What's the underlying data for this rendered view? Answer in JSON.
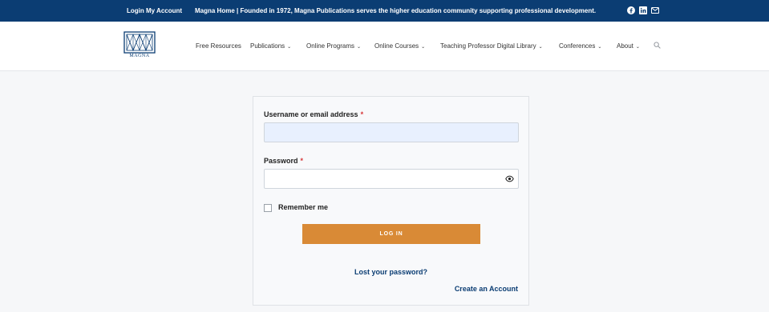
{
  "topbar": {
    "login": "Login",
    "my_account": "My Account",
    "tagline": "Magna Home | Founded in 1972, Magna Publications serves the higher education community supporting professional development.",
    "social_icons": [
      "facebook-icon",
      "linkedin-icon",
      "email-icon"
    ]
  },
  "header": {
    "logo_text": "MAGNA",
    "nav": [
      {
        "label": "Free Resources",
        "dropdown": false
      },
      {
        "label": "Publications",
        "dropdown": true
      },
      {
        "label": "Online Programs",
        "dropdown": true
      },
      {
        "label": "Online Courses",
        "dropdown": true
      },
      {
        "label": "Teaching Professor Digital Library",
        "dropdown": true
      },
      {
        "label": "Conferences",
        "dropdown": true
      },
      {
        "label": "About",
        "dropdown": true
      }
    ],
    "chevron": "⌄"
  },
  "form": {
    "username_label": "Username or email address",
    "password_label": "Password",
    "required_mark": "*",
    "username_value": "",
    "password_value": "",
    "remember_label": "Remember me",
    "login_button": "LOG IN",
    "lost_password": "Lost your password?",
    "create_account": "Create an Account"
  },
  "colors": {
    "brand_navy": "#0b3d73",
    "button_orange": "#d98a36",
    "required_red": "#d63638",
    "autofill_blue": "#e8f0fe"
  }
}
